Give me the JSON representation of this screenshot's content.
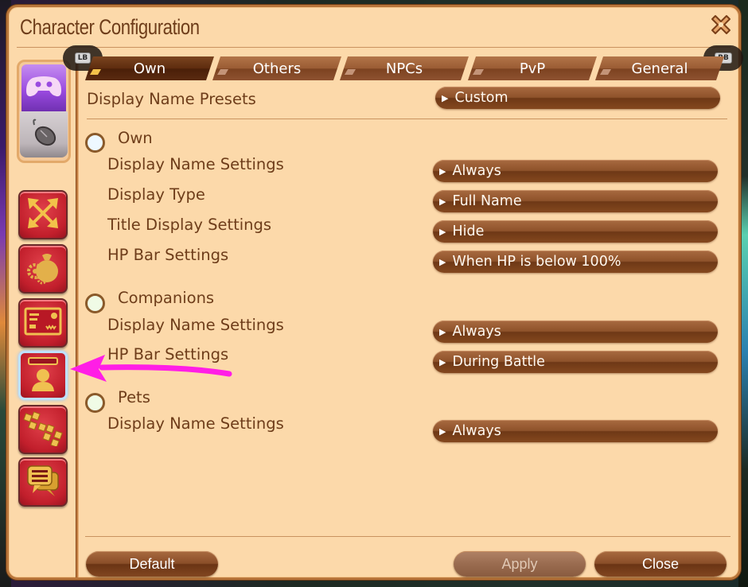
{
  "window": {
    "title": "Character Configuration"
  },
  "shoulder_buttons": {
    "left": "LB",
    "right": "RB"
  },
  "tabs": [
    {
      "label": "Own",
      "active": true
    },
    {
      "label": "Others",
      "active": false
    },
    {
      "label": "NPCs",
      "active": false
    },
    {
      "label": "PvP",
      "active": false
    },
    {
      "label": "General",
      "active": false
    }
  ],
  "presets": {
    "label": "Display Name Presets",
    "value": "Custom"
  },
  "sections": [
    {
      "title": "Own",
      "settings": [
        {
          "label": "Display Name Settings",
          "value": "Always"
        },
        {
          "label": "Display Type",
          "value": "Full Name"
        },
        {
          "label": "Title Display Settings",
          "value": "Hide"
        },
        {
          "label": "HP Bar Settings",
          "value": "When HP is below 100%"
        }
      ]
    },
    {
      "title": "Companions",
      "settings": [
        {
          "label": "Display Name Settings",
          "value": "Always"
        },
        {
          "label": "HP Bar Settings",
          "value": "During Battle"
        }
      ]
    },
    {
      "title": "Pets",
      "settings": [
        {
          "label": "Display Name Settings",
          "value": "Always"
        }
      ]
    }
  ],
  "sidebar": {
    "mode_switch": [
      "gamepad-icon",
      "mouse-icon"
    ],
    "items": [
      {
        "icon": "expand-arrows-icon",
        "active": false
      },
      {
        "icon": "bag-gears-icon",
        "active": false
      },
      {
        "icon": "id-card-icon",
        "active": false
      },
      {
        "icon": "character-nameplate-icon",
        "active": true
      },
      {
        "icon": "party-chain-icon",
        "active": false
      },
      {
        "icon": "chat-bubbles-icon",
        "active": false
      }
    ]
  },
  "footer": {
    "default_label": "Default",
    "apply_label": "Apply",
    "close_label": "Close"
  },
  "colors": {
    "panel_bg": "#fcd9aa",
    "text_brown": "#6e3d1a",
    "accent_brown": "#8e522a",
    "sidebar_red": "#c21f2c",
    "annotation_magenta": "#ff1ee6"
  }
}
